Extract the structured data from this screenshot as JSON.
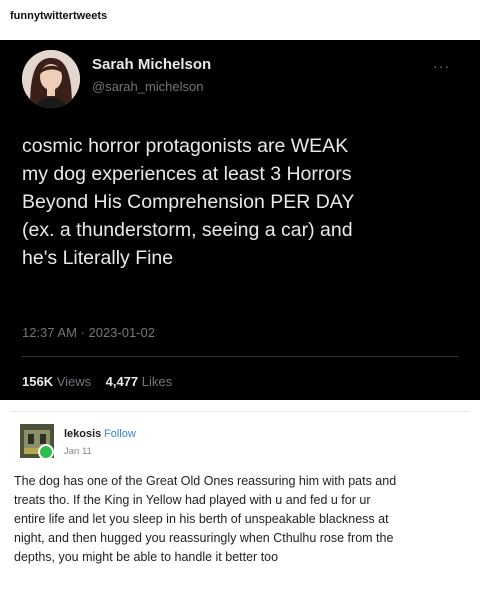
{
  "blog_name": "funnytwittertweets",
  "tweet": {
    "name": "Sarah Michelson",
    "handle": "@sarah_michelson",
    "more": "···",
    "lines": [
      "cosmic horror protagonists are WEAK",
      "my dog experiences at least 3 Horrors",
      "Beyond His Comprehension PER DAY",
      "(ex. a thunderstorm, seeing a car) and",
      "he's Literally Fine"
    ],
    "timestamp": "12:37 AM · 2023-01-02",
    "views_count": "156K",
    "views_label": "Views",
    "likes_count": "4,477",
    "likes_label": "Likes"
  },
  "reply": {
    "username": "lekosis",
    "follow_label": "Follow",
    "date": "Jan 11",
    "lines": [
      "The dog has one of the Great Old Ones reassuring him with pats and",
      "treats tho. If the King in Yellow had played with u and fed u for ur",
      "entire life and let you sleep in his berth of unspeakable blackness at",
      "night, and then hugged you reassuringly when Cthulhu rose from the",
      "depths, you might be able to handle it better too"
    ]
  }
}
